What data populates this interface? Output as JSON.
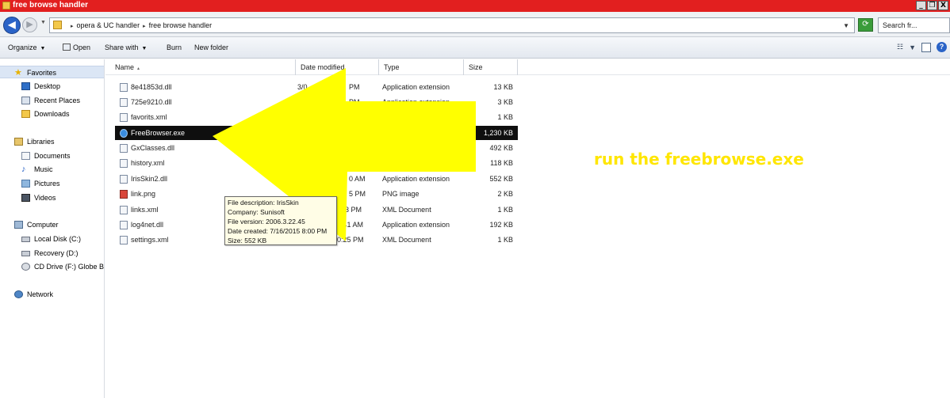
{
  "window": {
    "title": "free browse handler",
    "controls": {
      "minimize": "_",
      "restore": "❐",
      "close": "X"
    }
  },
  "address": {
    "crumbs": [
      "opera & UC handler",
      "free browse handler"
    ],
    "search_placeholder": "Search fr..."
  },
  "toolbar": {
    "organize": "Organize",
    "open": "Open",
    "share_with": "Share with",
    "burn": "Burn",
    "new_folder": "New folder"
  },
  "navigation": {
    "favorites": {
      "label": "Favorites",
      "items": [
        "Desktop",
        "Recent Places",
        "Downloads"
      ]
    },
    "libraries": {
      "label": "Libraries",
      "items": [
        "Documents",
        "Music",
        "Pictures",
        "Videos"
      ]
    },
    "computer": {
      "label": "Computer",
      "items": [
        "Local Disk (C:)",
        "Recovery (D:)",
        "CD Drive (F:) Globe B"
      ]
    },
    "network": {
      "label": "Network"
    }
  },
  "columns": {
    "name": "Name",
    "date_modified": "Date modified",
    "type": "Type",
    "size": "Size"
  },
  "files": [
    {
      "name": "8e41853d.dll",
      "date": "3/0",
      "date_tail": "PM",
      "type": "Application extension",
      "size": "13 KB"
    },
    {
      "name": "725e9210.dll",
      "date": "",
      "date_tail": "PM",
      "type": "Application extension",
      "size": "3 KB"
    },
    {
      "name": "favorits.xml",
      "date": "",
      "date_tail": "",
      "type": "",
      "size": "1 KB"
    },
    {
      "name": "FreeBrowser.exe",
      "date": "",
      "date_tail": "",
      "type": "",
      "size": "1,230 KB"
    },
    {
      "name": "GxClasses.dll",
      "date": "",
      "date_tail": "",
      "type": "",
      "size": "492 KB"
    },
    {
      "name": "history.xml",
      "date": "",
      "date_tail": "",
      "type": "",
      "size": "118 KB"
    },
    {
      "name": "IrisSkin2.dll",
      "date": "",
      "date_tail": "0 AM",
      "type": "Application extension",
      "size": "552 KB"
    },
    {
      "name": "link.png",
      "date": "4/23/",
      "date_tail": "5 PM",
      "type": "PNG image",
      "size": "2 KB"
    },
    {
      "name": "links.xml",
      "date": "",
      "date_tail": "33 PM",
      "type": "XML Document",
      "size": "1 KB"
    },
    {
      "name": "log4net.dll",
      "date": "",
      "date_tail": "0:41 AM",
      "type": "Application extension",
      "size": "192 KB"
    },
    {
      "name": "settings.xml",
      "date": "",
      "date_tail": "0:25 PM",
      "type": "XML Document",
      "size": "1 KB"
    }
  ],
  "tooltip": {
    "description": "File description: IrisSkin",
    "company": "Company: Sunisoft",
    "version": "File version: 2006.3.22.45",
    "created": "Date created: 7/16/2015 8:00 PM",
    "size": "Size: 552 KB"
  },
  "annotation": {
    "text": "run the freebrowse.exe",
    "color": "#ffe600"
  },
  "colors": {
    "titlebar": "#e21f1f",
    "selection": "#0f0f0f",
    "arrow": "#ffff00"
  }
}
